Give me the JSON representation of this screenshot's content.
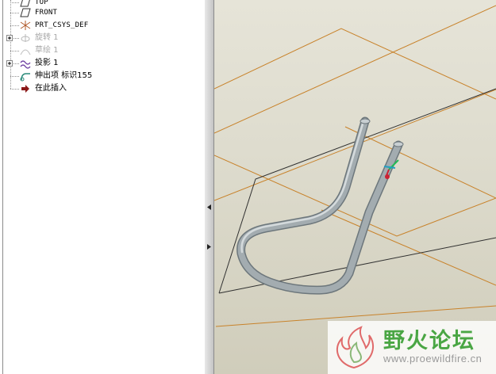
{
  "model_tree": {
    "items": [
      {
        "label": "TOP",
        "icon": "datum-plane-icon",
        "dim": false,
        "mono": true,
        "expandable": false
      },
      {
        "label": "FRONT",
        "icon": "datum-plane-icon",
        "dim": false,
        "mono": true,
        "expandable": false
      },
      {
        "label": "PRT_CSYS_DEF",
        "icon": "coordinate-system-icon",
        "dim": false,
        "mono": true,
        "expandable": false
      },
      {
        "label": "旋转 1",
        "icon": "revolve-icon",
        "dim": true,
        "mono": false,
        "expandable": true
      },
      {
        "label": "草绘 1",
        "icon": "sketch-icon",
        "dim": true,
        "mono": false,
        "expandable": false
      },
      {
        "label": "投影 1",
        "icon": "projection-icon",
        "dim": false,
        "mono": false,
        "expandable": true
      },
      {
        "label": "伸出项 标识155",
        "icon": "sweep-icon",
        "dim": false,
        "mono": false,
        "expandable": false
      },
      {
        "label": "在此插入",
        "icon": "insert-here-arrow-icon",
        "dim": false,
        "mono": false,
        "expandable": false
      }
    ]
  },
  "splitter": {
    "collapse_left_icon": "triangle-left-icon",
    "expand_right_icon": "triangle-right-icon"
  },
  "watermark": {
    "title": "野火论坛",
    "url": "www.proewildfire.cn",
    "logo_icon": "flame-logo-icon"
  },
  "colors": {
    "datum_plane_edge": "#c8822a",
    "pipe_body": "#9aa3a8",
    "viewport_bg": "#dedcce",
    "watermark_green": "#4aa644"
  }
}
